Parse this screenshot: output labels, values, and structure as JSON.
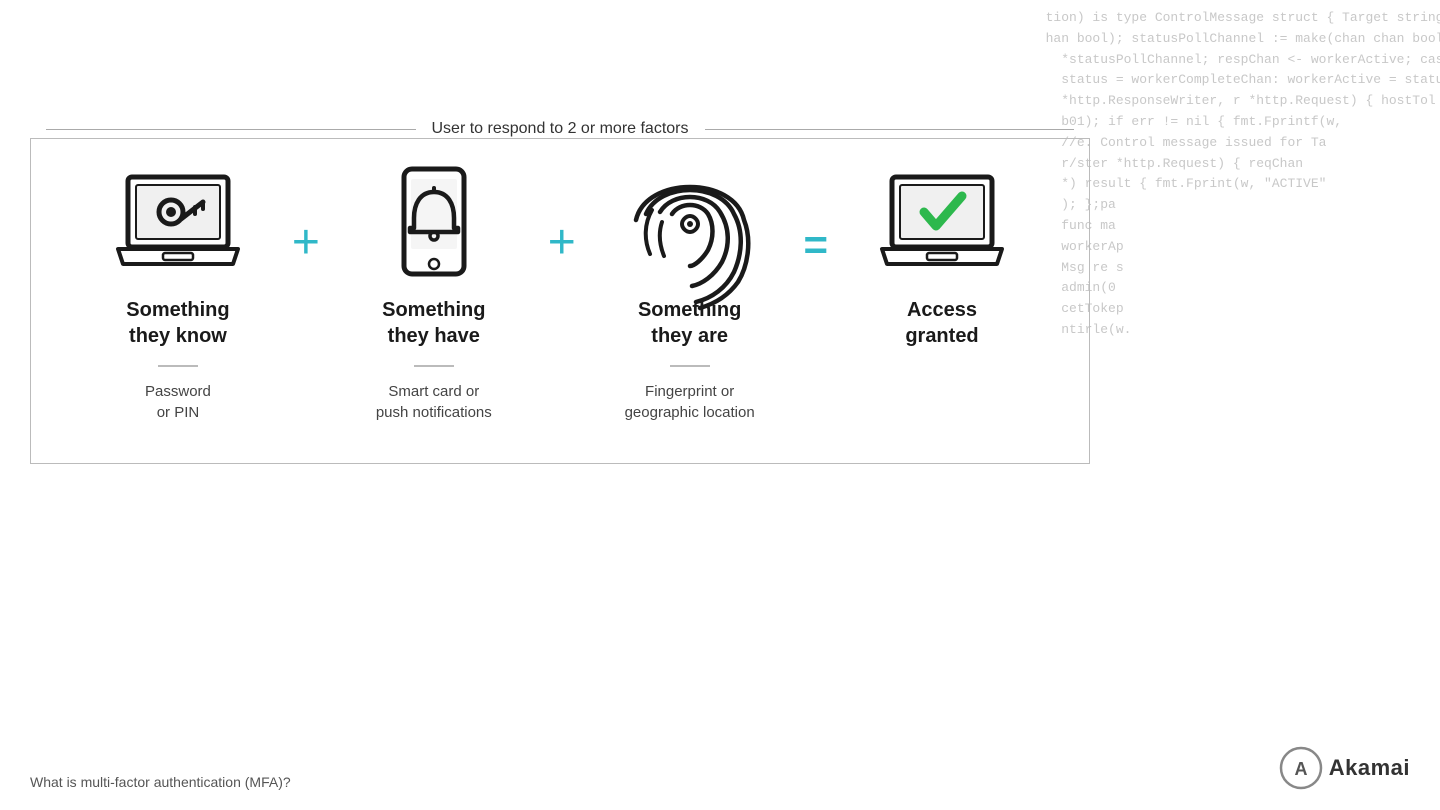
{
  "code_bg": {
    "lines": [
      "tion) is type ControlMessage struct { Target string; Co",
      "han bool); statusPollChannel := make(chan chan bool); v",
      "  *statusPollChannel; respChan <- workerActive; case",
      "  status = workerCompleteChan: workerActive = status;",
      "  *http.ResponseWriter, r *http.Request) { hostTol",
      "  b01); if err != nil { fmt.Fprintf(w,",
      "  //e. Control message issued for Ta",
      "  r/ster *http.Request) { reqChan",
      "  *) result { fmt.Fprint(w, \"ACTIVE\"",
      "  ); };pa",
      "  func ma",
      "  workerAp",
      "  Msg re s",
      "  admin(0",
      "  cetTokep",
      "  ntirle(w."
    ]
  },
  "diagram": {
    "title": "User to respond to 2 or more factors",
    "factors": [
      {
        "id": "something-know",
        "title": "Something\nthey know",
        "subtitle": "Password\nor PIN",
        "icon_type": "laptop-key"
      },
      {
        "id": "something-have",
        "title": "Something\nthey have",
        "subtitle": "Smart card or\npush notifications",
        "icon_type": "phone-bell"
      },
      {
        "id": "something-are",
        "title": "Something\nthey are",
        "subtitle": "Fingerprint or\ngeographic location",
        "icon_type": "fingerprint"
      },
      {
        "id": "access-granted",
        "title": "Access\ngranted",
        "subtitle": "",
        "icon_type": "laptop-check"
      }
    ],
    "plus_label": "+",
    "equals_label": "="
  },
  "bottom": {
    "label": "What is multi-factor authentication (MFA)?",
    "logo_text": "Akamai"
  }
}
